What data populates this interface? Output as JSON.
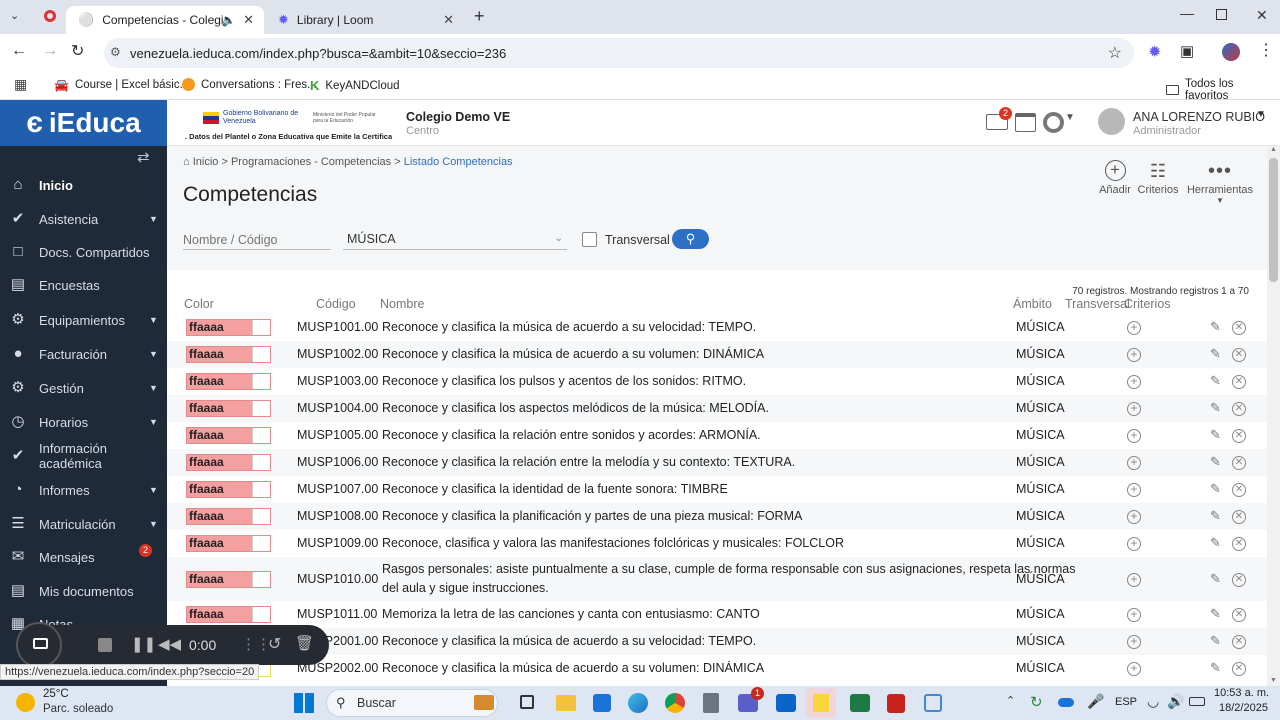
{
  "browser": {
    "tabs": [
      {
        "title": "Competencias - Colegio De",
        "active": true
      },
      {
        "title": "Library | Loom",
        "active": false
      }
    ],
    "url": "venezuela.ieduca.com/index.php?busca=&ambit=10&seccio=236",
    "bookmarks": [
      "Course | Excel básic...",
      "Conversations : Fres...",
      "KeyANDCloud"
    ],
    "all_bookmarks": "Todos los favoritos",
    "status_url": "https://venezuela.ieduca.com/index.php?seccio=20"
  },
  "app": {
    "logo": "iEduca",
    "gov_line1": "Gobierno Bolivariano de Venezuela",
    "gov_line2": "Ministerio del Poder Popular para la Educación",
    "gov_caption": ". Datos del Plantel o Zona Educativa que Emite la Certifica",
    "school_name": "Colegio Demo VE",
    "school_sub": "Centro",
    "mail_badge": "2",
    "user_name": "ANA LORENZO RUBIO",
    "user_role": "Administrador"
  },
  "sidebar": {
    "items": [
      {
        "label": "Inicio",
        "icon": "home-icon",
        "caret": false
      },
      {
        "label": "Asistencia",
        "icon": "check-circle-icon",
        "caret": true
      },
      {
        "label": "Docs. Compartidos",
        "icon": "folder-icon",
        "caret": false
      },
      {
        "label": "Encuestas",
        "icon": "clipboard-icon",
        "caret": false
      },
      {
        "label": "Equipamientos",
        "icon": "cogs-icon",
        "caret": true
      },
      {
        "label": "Facturación",
        "icon": "coins-icon",
        "caret": true
      },
      {
        "label": "Gestión",
        "icon": "gear-icon",
        "caret": true
      },
      {
        "label": "Horarios",
        "icon": "clock-icon",
        "caret": true
      },
      {
        "label": "Información académica",
        "icon": "check-circle-icon",
        "caret": false
      },
      {
        "label": "Informes",
        "icon": "pie-chart-icon",
        "caret": true
      },
      {
        "label": "Matriculación",
        "icon": "list-icon",
        "caret": true
      },
      {
        "label": "Mensajes",
        "icon": "envelope-icon",
        "caret": false,
        "badge": "2"
      },
      {
        "label": "Mis documentos",
        "icon": "document-icon",
        "caret": false
      },
      {
        "label": "Notas",
        "icon": "table-icon",
        "caret": false
      }
    ]
  },
  "main": {
    "breadcrumb": {
      "home": "Inicio",
      "sep1": ">",
      "level1": "Programaciones - Competencias",
      "sep2": ">",
      "current": "Listado Competencias"
    },
    "title": "Competencias",
    "actions": {
      "add": "Añadir",
      "criteria": "Criterios",
      "tools": "Herramientas"
    },
    "filters": {
      "search_placeholder": "Nombre / Código",
      "area": "MÚSICA",
      "transversal": "Transversal"
    },
    "records_info": "70 registros. Mostrando registros 1 a 70",
    "columns": {
      "color": "Color",
      "code": "Código",
      "name": "Nombre",
      "scope": "Ámbito",
      "transversal": "Transversal",
      "criteria": "Criterios"
    },
    "rows": [
      {
        "color": "ffaaaa",
        "code": "MUSP1001.00",
        "name": "Reconoce y clasifica la música de acuerdo a su velocidad: TEMPO.",
        "scope": "MÚSICA"
      },
      {
        "color": "ffaaaa",
        "code": "MUSP1002.00",
        "name": "Reconoce y clasifica la música de acuerdo a su volumen: DINÁMICA",
        "scope": "MÚSICA"
      },
      {
        "color": "ffaaaa",
        "code": "MUSP1003.00",
        "name": "Reconoce y clasifica los pulsos y acentos de los sonidos: RITMO.",
        "scope": "MÚSICA"
      },
      {
        "color": "ffaaaa",
        "code": "MUSP1004.00",
        "name": "Reconoce y clasifica los aspectos melódicos de la música: MELODÍA.",
        "scope": "MÚSICA"
      },
      {
        "color": "ffaaaa",
        "code": "MUSP1005.00",
        "name": "Reconoce y clasifica la relación entre sonidos y acordes: ARMONÍA.",
        "scope": "MÚSICA"
      },
      {
        "color": "ffaaaa",
        "code": "MUSP1006.00",
        "name": "Reconoce y clasifica la relación entre la melodía y su contexto: TEXTURA.",
        "scope": "MÚSICA"
      },
      {
        "color": "ffaaaa",
        "code": "MUSP1007.00",
        "name": "Reconoce y clasifica la identidad de la fuente sonora: TIMBRE",
        "scope": "MÚSICA"
      },
      {
        "color": "ffaaaa",
        "code": "MUSP1008.00",
        "name": "Reconoce y clasifica la planificación y partes de una pieza musical: FORMA",
        "scope": "MÚSICA"
      },
      {
        "color": "ffaaaa",
        "code": "MUSP1009.00",
        "name": "Reconoce, clasifica y valora las manifestaciones folclóricas y musicales: FOLCLOR",
        "scope": "MÚSICA"
      },
      {
        "color": "ffaaaa",
        "code": "MUSP1010.00",
        "name": "Rasgos personales: asiste puntualmente a su clase, cumple de forma responsable con sus asignaciones, respeta las normas",
        "name2": "del aula y sigue instrucciones.",
        "scope": "MÚSICA"
      },
      {
        "color": "ffaaaa",
        "code": "MUSP1011.00",
        "name": "Memoriza la letra de las canciones y canta con entusiasmo: CANTO",
        "scope": "MÚSICA"
      },
      {
        "color": "ffffaa",
        "code": "MUSP2001.00",
        "name": "Reconoce y clasifica la música de acuerdo a su velocidad: TEMPO.",
        "scope": "MÚSICA"
      },
      {
        "color": "ffffaa",
        "code": "MUSP2002.00",
        "name": "Reconoce y clasifica la música de acuerdo a su volumen: DINÁMICA",
        "scope": "MÚSICA"
      }
    ]
  },
  "recorder": {
    "time": "0:00"
  },
  "taskbar": {
    "weather_temp": "25°C",
    "weather_desc": "Parc. soleado",
    "search": "Buscar",
    "lang": "ESP",
    "time": "10:53 a. m.",
    "date": "18/2/2025",
    "teams_badge": "1"
  }
}
